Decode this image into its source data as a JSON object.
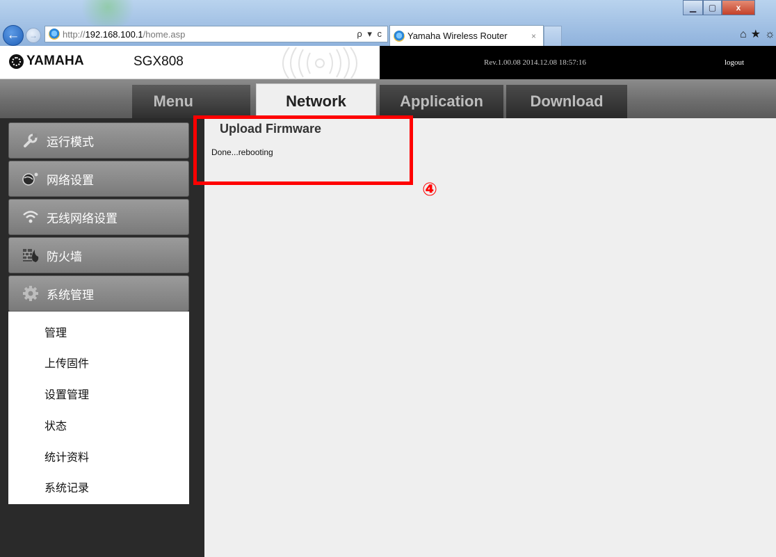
{
  "browser": {
    "url_prefix": "http://",
    "url_host": "192.168.100.1",
    "url_path": "/home.asp",
    "address_tools": "ρ ▾ c",
    "tab_title": "Yamaha Wireless Router",
    "tab_close": "×",
    "win_min": "▁",
    "win_max": "▢",
    "win_close": "x",
    "toolbar_icons": "⌂★☼"
  },
  "header": {
    "brand": "YAMAHA",
    "model": "SGX808",
    "firmware_rev": "Rev.1.00.08  2014.12.08 18:57:16",
    "logout": "logout"
  },
  "nav": {
    "tabs": [
      {
        "label": "Menu"
      },
      {
        "label": "Network",
        "active": true
      },
      {
        "label": "Application"
      },
      {
        "label": "Download"
      }
    ]
  },
  "sidebar": {
    "items": [
      {
        "label": "运行模式",
        "icon": "wrench-icon"
      },
      {
        "label": "网络设置",
        "icon": "globe-icon"
      },
      {
        "label": "无线网络设置",
        "icon": "wifi-icon"
      },
      {
        "label": "防火墙",
        "icon": "firewall-icon"
      },
      {
        "label": "系统管理",
        "icon": "gear-icon",
        "expanded": true
      }
    ],
    "submenu": [
      {
        "label": "管理"
      },
      {
        "label": "上传固件"
      },
      {
        "label": "设置管理"
      },
      {
        "label": "状态"
      },
      {
        "label": "统计资料"
      },
      {
        "label": "系统记录"
      }
    ]
  },
  "main": {
    "title": "Upload Firmware",
    "status": "Done...rebooting"
  },
  "annotation": {
    "step": "④",
    "color": "#ff0000"
  }
}
